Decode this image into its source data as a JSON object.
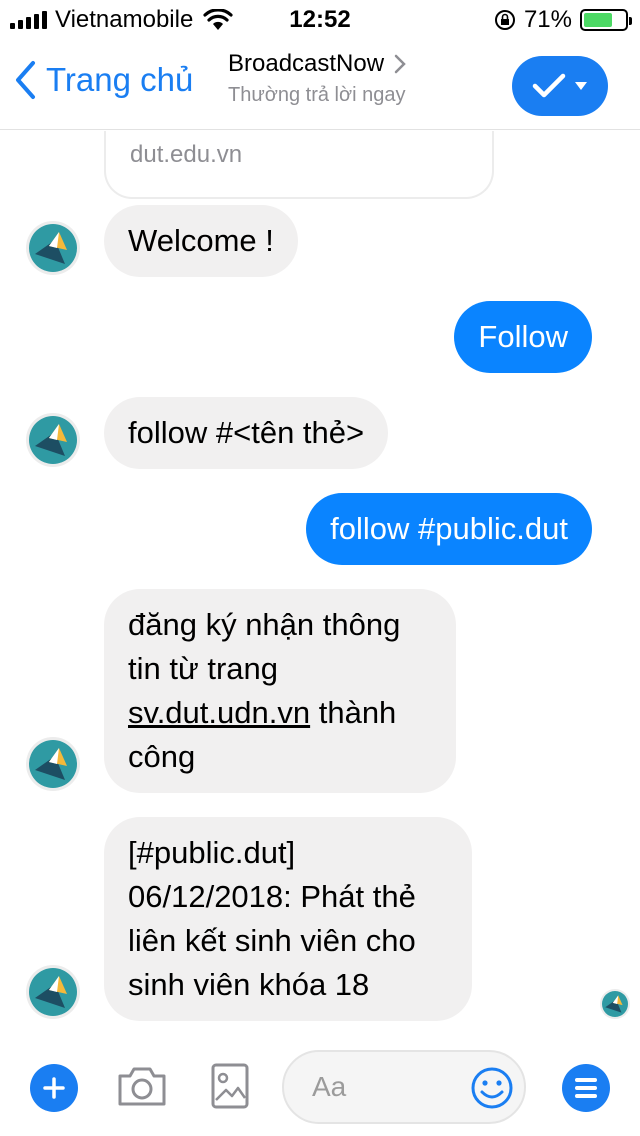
{
  "status_bar": {
    "carrier": "Vietnamobile",
    "time": "12:52",
    "battery_percent": "71%",
    "battery_level": 0.71
  },
  "nav": {
    "back_label": "Trang chủ",
    "title": "BroadcastNow",
    "subtitle": "Thường trả lời ngay"
  },
  "link_card": {
    "domain": "dut.edu.vn"
  },
  "messages": [
    {
      "from": "bot",
      "text": "Welcome !"
    },
    {
      "from": "me",
      "text": "Follow"
    },
    {
      "from": "bot",
      "text": "follow #<tên thẻ>"
    },
    {
      "from": "me",
      "text": "follow #public.dut"
    },
    {
      "from": "bot",
      "line1": "đăng ký nhận thông",
      "line2": "tin từ trang",
      "link": "sv.dut.udn.vn",
      "after_link": " thành",
      "line4": "công"
    },
    {
      "from": "bot",
      "line1": "[#public.dut]",
      "line2": "06/12/2018: Phát thẻ",
      "line3": "liên kết sinh viên cho",
      "line4": "sinh viên khóa 18"
    }
  ],
  "composer": {
    "placeholder": "Aa"
  },
  "colors": {
    "accent": "#1a7ef2",
    "outgoing_bubble": "#0a84ff",
    "incoming_bubble": "#f1f0f0",
    "battery": "#4cd964"
  },
  "icons": [
    "signal-icon",
    "wifi-icon",
    "lock-rotation-icon",
    "battery-icon",
    "back-chevron-icon",
    "chevron-right-icon",
    "check-icon",
    "caret-down-icon",
    "bot-avatar-icon",
    "plus-icon",
    "camera-icon",
    "image-icon",
    "emoji-icon",
    "menu-icon"
  ]
}
